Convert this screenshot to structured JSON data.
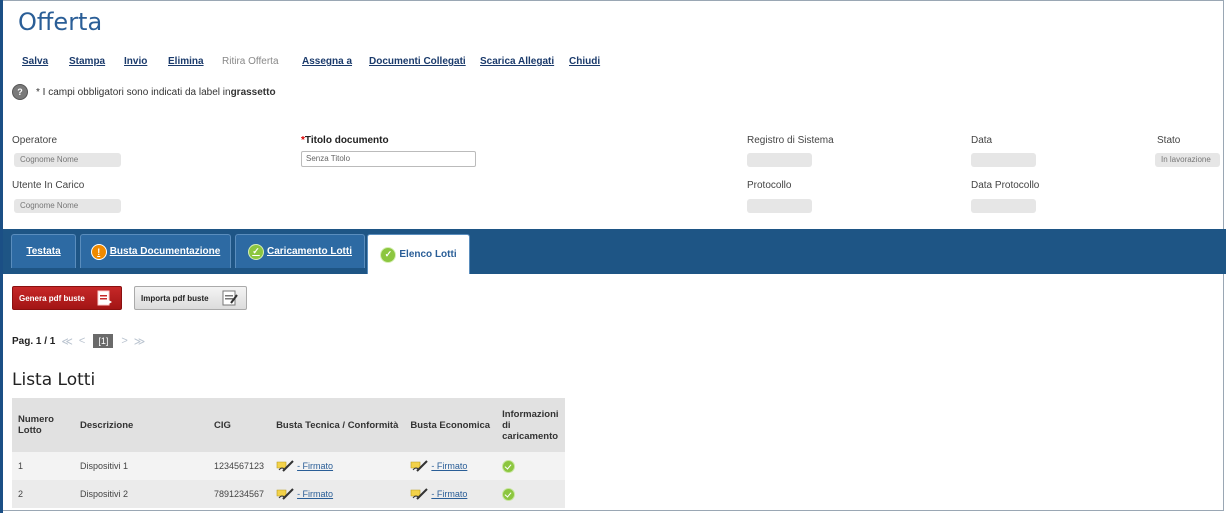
{
  "page": {
    "title": "Offerta"
  },
  "toolbar": {
    "items": [
      "Salva",
      "Stampa",
      "Invio",
      "Elimina",
      "Ritira Offerta",
      "Assegna a",
      "Documenti Collegati",
      "Scarica Allegati",
      "Chiudi"
    ]
  },
  "info": {
    "text": "* I campi obbligatori sono indicati da label in ",
    "bold": "grassetto",
    "icon": "info-icon"
  },
  "form": {
    "operatore_label": "Operatore",
    "operatore_value": "Cognome Nome",
    "utente_label": "Utente In Carico",
    "utente_value": "Cognome Nome",
    "titolo_required": "*",
    "titolo_label": "Titolo documento",
    "titolo_value": "Senza Titolo",
    "registro_label": "Registro di Sistema",
    "data_label": "Data",
    "stato_label": "Stato",
    "stato_value": "In lavorazione",
    "protocollo_label": "Protocollo",
    "data_protocollo_label": "Data Protocollo"
  },
  "tabs": [
    {
      "label": "Testata",
      "icon": ""
    },
    {
      "label": "Busta Documentazione",
      "icon": "warning-icon"
    },
    {
      "label": "Caricamento Lotti",
      "icon": "check-icon"
    },
    {
      "label": "Elenco Lotti",
      "icon": "check-icon",
      "active": true
    }
  ],
  "actions": {
    "genera": "Genera pdf buste",
    "importa": "Importa pdf buste"
  },
  "pager": {
    "label": "Pag. 1 / 1",
    "first": "≪",
    "prev": "<",
    "current": "[1]",
    "next": ">",
    "last": "≫"
  },
  "lotti": {
    "title": "Lista Lotti",
    "headers": [
      "Numero Lotto",
      "Descrizione",
      "CIG",
      "Busta Tecnica / Conformità",
      "Busta Economica",
      "Informazioni di caricamento"
    ],
    "rows": [
      {
        "numero": "1",
        "descrizione": "Dispositivi 1",
        "cig": "1234567123",
        "tecnica": "- Firmato",
        "economica": "- Firmato"
      },
      {
        "numero": "2",
        "descrizione": "Dispositivi 2",
        "cig": "7891234567",
        "tecnica": "- Firmato",
        "economica": "- Firmato"
      }
    ]
  },
  "colors": {
    "brand": "#1e5585",
    "title": "#2a5e97",
    "danger": "#c62828",
    "success": "#8cc63f",
    "warning": "#f08a00"
  }
}
